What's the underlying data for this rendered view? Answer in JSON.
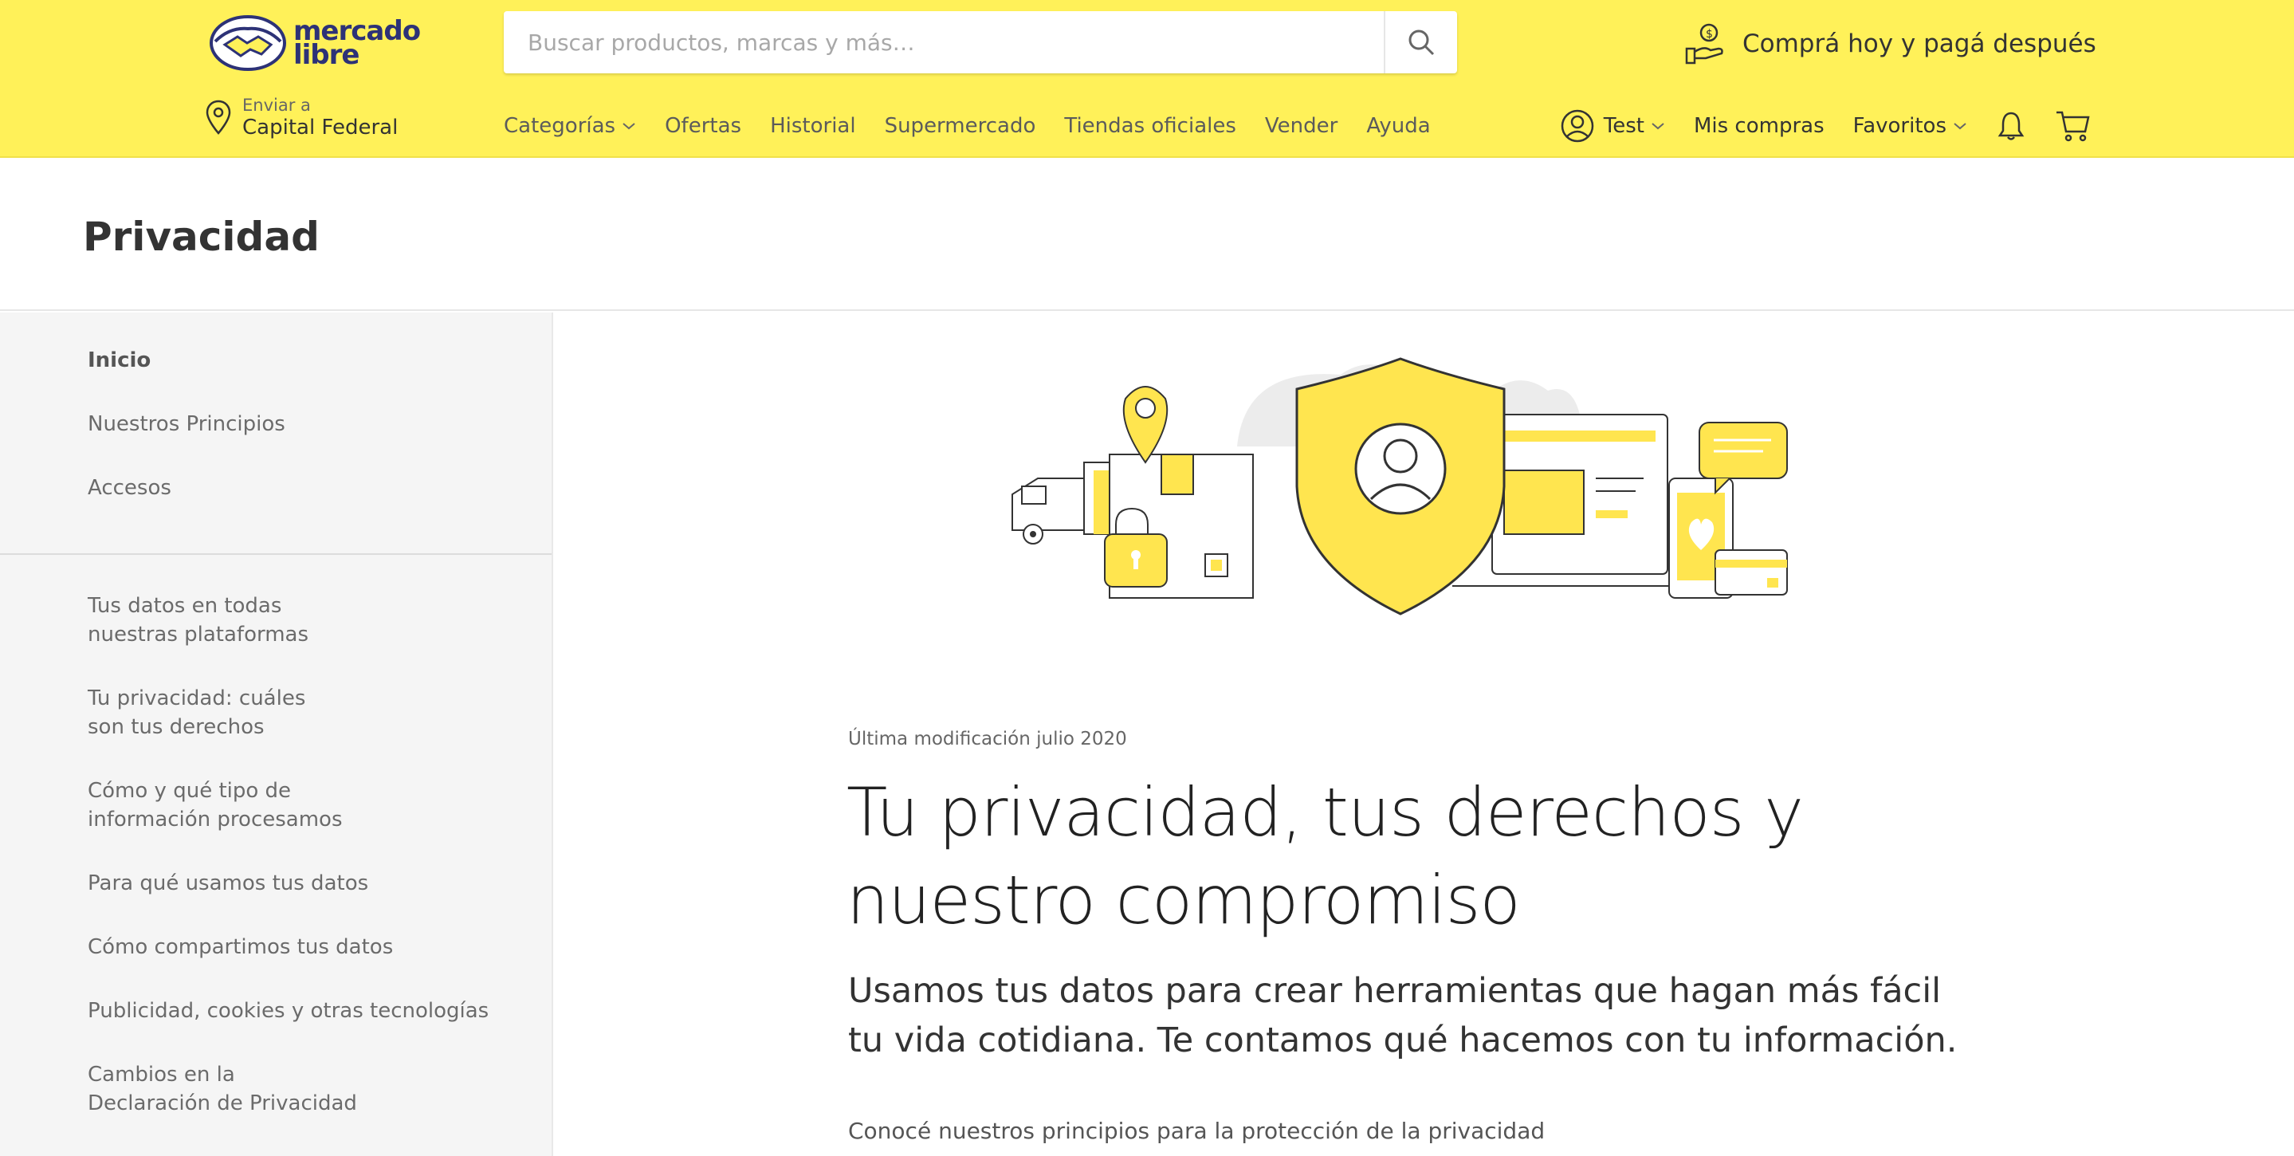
{
  "header": {
    "logo": {
      "line1": "mercado",
      "line2": "libre"
    },
    "search_placeholder": "Buscar productos, marcas y más…",
    "promo_text": "Comprá hoy y pagá después",
    "location": {
      "label": "Enviar a",
      "value": "Capital Federal"
    },
    "nav": [
      "Categorías",
      "Ofertas",
      "Historial",
      "Supermercado",
      "Tiendas oficiales",
      "Vender",
      "Ayuda"
    ],
    "user": {
      "name": "Test",
      "purchases": "Mis compras",
      "favorites": "Favoritos"
    }
  },
  "page": {
    "title": "Privacidad"
  },
  "sidebar": {
    "top_items": [
      "Inicio",
      "Nuestros Principios",
      "Accesos"
    ],
    "sections": [
      "Tus datos en todas nuestras plataformas",
      "Tu privacidad: cuáles son tus derechos",
      "Cómo y qué tipo de información procesamos",
      "Para qué usamos tus datos",
      "Cómo compartimos tus datos",
      "Publicidad, cookies y otras tecnologías",
      "Cambios en la Declaración de Privacidad"
    ]
  },
  "main": {
    "meta": "Última modificación julio 2020",
    "headline": "Tu privacidad, tus derechos y nuestro compromiso",
    "lead": "Usamos tus datos para crear herramientas que hagan más fácil tu vida cotidiana. Te contamos qué hacemos con tu información.",
    "sub": "Conocé nuestros principios para la protección de la privacidad"
  },
  "colors": {
    "brand_yellow": "#fff159",
    "logo_blue": "#2d3277",
    "illustration_yellow": "#ffe54f"
  }
}
